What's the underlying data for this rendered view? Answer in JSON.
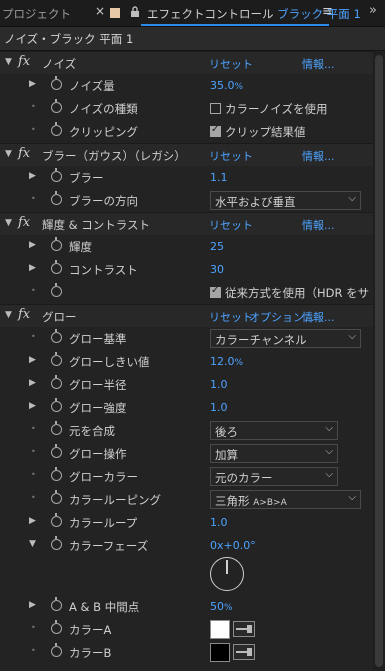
{
  "tabs": {
    "project": "プロジェクト",
    "close": "×",
    "effect_controls": "エフェクトコントロール",
    "effect_controls_layer": "ブラック 平面 1",
    "menu": "≡",
    "more": "»"
  },
  "layer_title": "ノイズ・ブラック 平面 1",
  "effects": {
    "noise": {
      "name": "ノイズ",
      "reset": "リセット",
      "about": "情報...",
      "amount_label": "ノイズ量",
      "amount_value": "35.0",
      "amount_unit": "%",
      "type_label": "ノイズの種類",
      "type_check": "カラーノイズを使用",
      "clip_label": "クリッピング",
      "clip_check": "クリップ結果値"
    },
    "blur": {
      "name": "ブラー（ガウス）（レガシ）",
      "reset": "リセット",
      "about": "情報...",
      "amount_label": "ブラー",
      "amount_value": "1.1",
      "dir_label": "ブラーの方向",
      "dir_value": "水平および垂直"
    },
    "bc": {
      "name": "輝度 & コントラスト",
      "reset": "リセット",
      "about": "情報...",
      "brightness_label": "輝度",
      "brightness_value": "25",
      "contrast_label": "コントラスト",
      "contrast_value": "30",
      "legacy_check": "従来方式を使用（HDR をサ"
    },
    "glow": {
      "name": "グロー",
      "reset": "リセット",
      "options": "オプション...",
      "about": "情報...",
      "based_label": "グロー基準",
      "based_value": "カラーチャンネル",
      "threshold_label": "グローしきい値",
      "threshold_value": "12.0",
      "threshold_unit": "%",
      "radius_label": "グロー半径",
      "radius_value": "1.0",
      "intensity_label": "グロー強度",
      "intensity_value": "1.0",
      "composite_label": "元を合成",
      "composite_value": "後ろ",
      "operation_label": "グロー操作",
      "operation_value": "加算",
      "colors_label": "グローカラー",
      "colors_value": "元のカラー",
      "looping_label": "カラールーピング",
      "looping_value": "三角形",
      "looping_value_suffix": "A>B>A",
      "loops_label": "カラーループ",
      "loops_value": "1.0",
      "phase_label": "カラーフェーズ",
      "phase_value": "0x+0.0°",
      "midpoint_label": "A & B 中間点",
      "midpoint_value": "50",
      "midpoint_unit": "%",
      "colorA_label": "カラーA",
      "colorA": "#ffffff",
      "colorB_label": "カラーB",
      "colorB": "#000000"
    }
  },
  "colors": {
    "accent": "#4da3ff",
    "tab_underline": "#2d8ceb"
  }
}
